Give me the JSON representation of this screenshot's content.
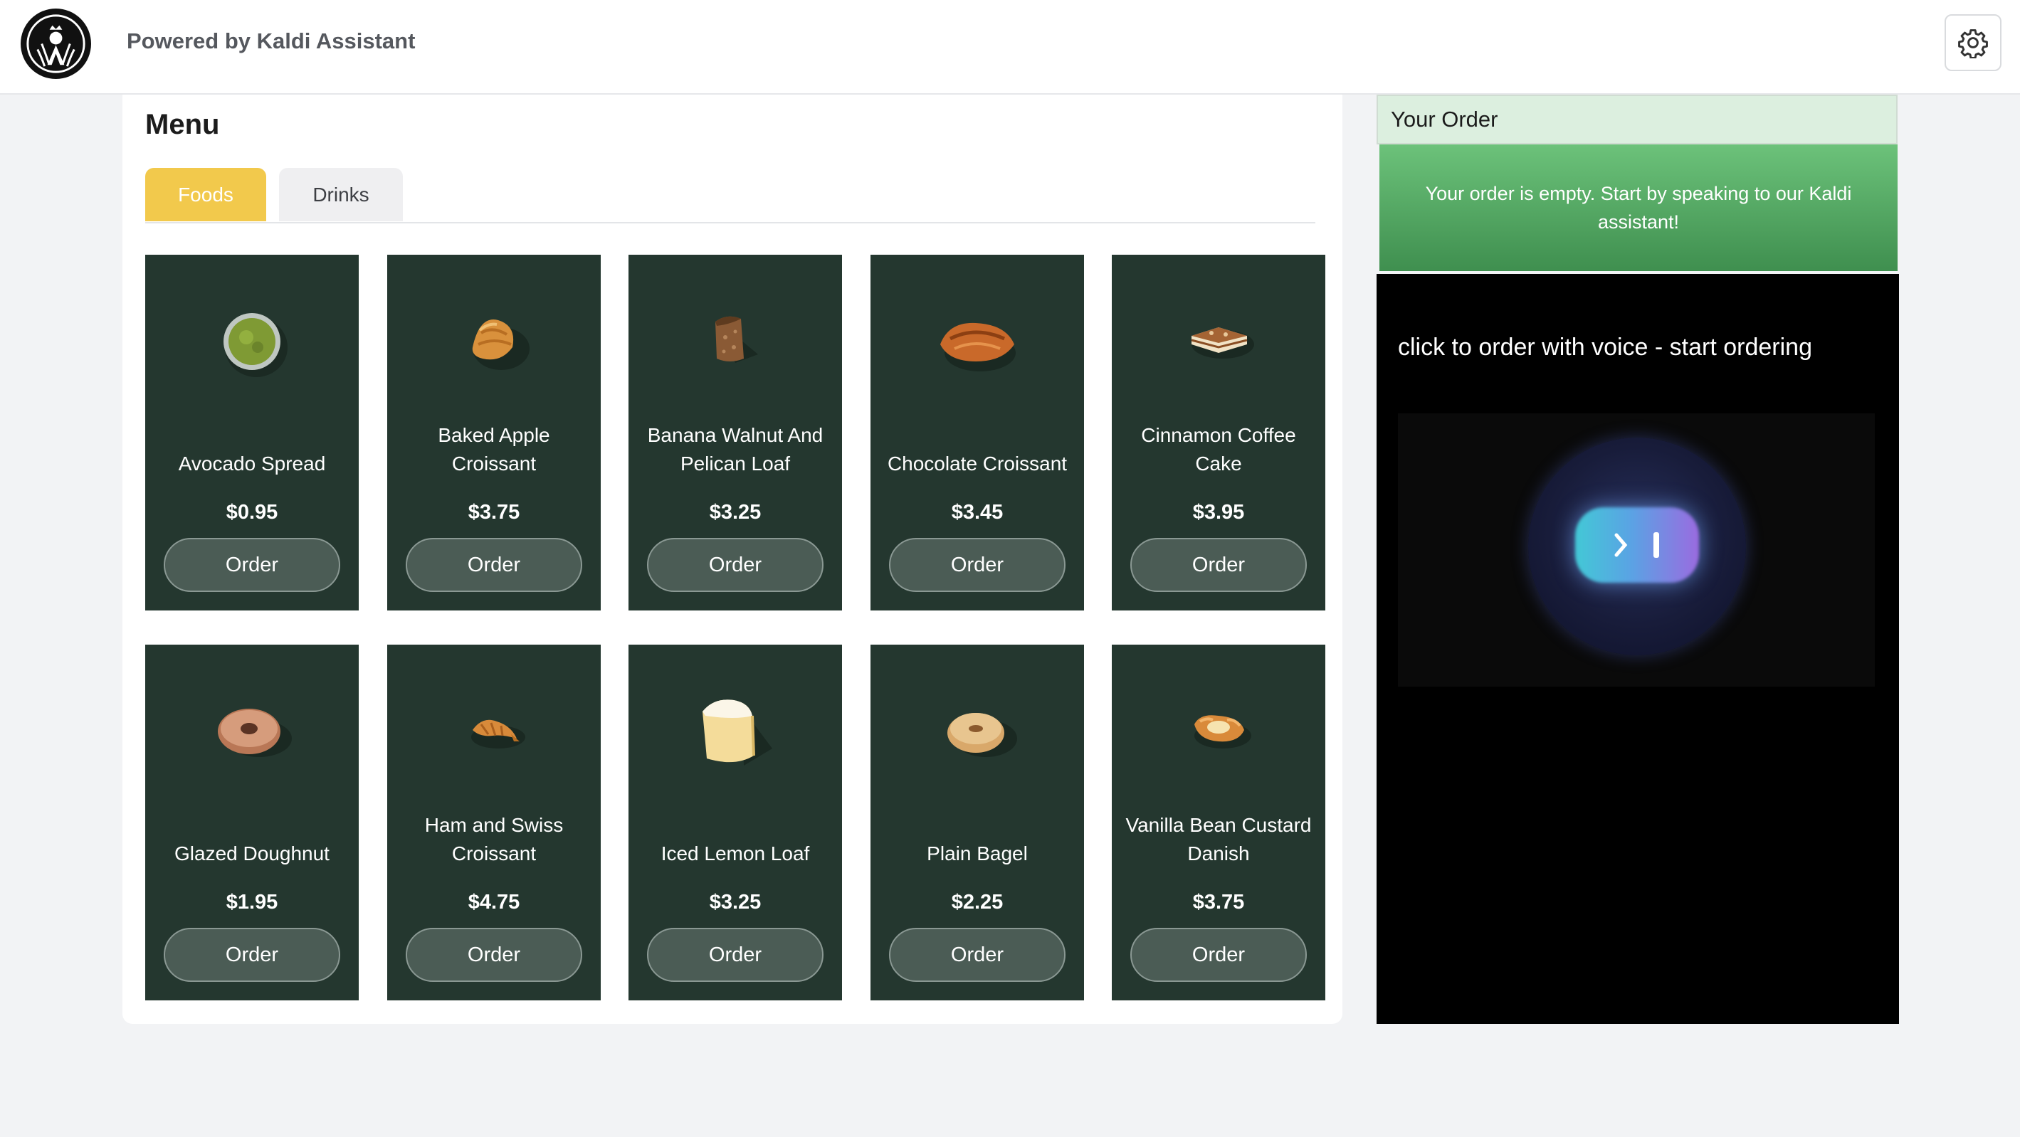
{
  "header": {
    "brand": "Powered by Kaldi Assistant",
    "logo_icon": "starbucks-siren-logo",
    "settings_icon": "gear-icon"
  },
  "menu": {
    "title": "Menu",
    "tabs": [
      {
        "label": "Foods",
        "active": true
      },
      {
        "label": "Drinks",
        "active": false
      }
    ],
    "items": [
      {
        "name": "Avocado Spread",
        "price": "$0.95",
        "button": "Order",
        "icon": "avocado-spread-icon"
      },
      {
        "name": "Baked Apple Croissant",
        "price": "$3.75",
        "button": "Order",
        "icon": "croissant-icon"
      },
      {
        "name": "Banana Walnut And Pelican Loaf",
        "price": "$3.25",
        "button": "Order",
        "icon": "loaf-icon"
      },
      {
        "name": "Chocolate Croissant",
        "price": "$3.45",
        "button": "Order",
        "icon": "chocolate-croissant-icon"
      },
      {
        "name": "Cinnamon Coffee Cake",
        "price": "$3.95",
        "button": "Order",
        "icon": "coffee-cake-icon"
      },
      {
        "name": "Glazed Doughnut",
        "price": "$1.95",
        "button": "Order",
        "icon": "doughnut-icon"
      },
      {
        "name": "Ham and Swiss Croissant",
        "price": "$4.75",
        "button": "Order",
        "icon": "croissant-icon"
      },
      {
        "name": "Iced Lemon Loaf",
        "price": "$3.25",
        "button": "Order",
        "icon": "lemon-loaf-icon"
      },
      {
        "name": "Plain Bagel",
        "price": "$2.25",
        "button": "Order",
        "icon": "bagel-icon"
      },
      {
        "name": "Vanilla Bean Custard Danish",
        "price": "$3.75",
        "button": "Order",
        "icon": "danish-icon"
      }
    ]
  },
  "order": {
    "title": "Your Order",
    "empty_message": "Your order is empty. Start by speaking to our Kaldi assistant!"
  },
  "voice": {
    "label": "click to order with voice - start ordering",
    "widget_icon": "voice-orb-icon"
  },
  "colors": {
    "card_bg": "#24372f",
    "tab_active": "#f2c94c",
    "order_green": "#4fa55f",
    "voice_bg": "#000000"
  }
}
